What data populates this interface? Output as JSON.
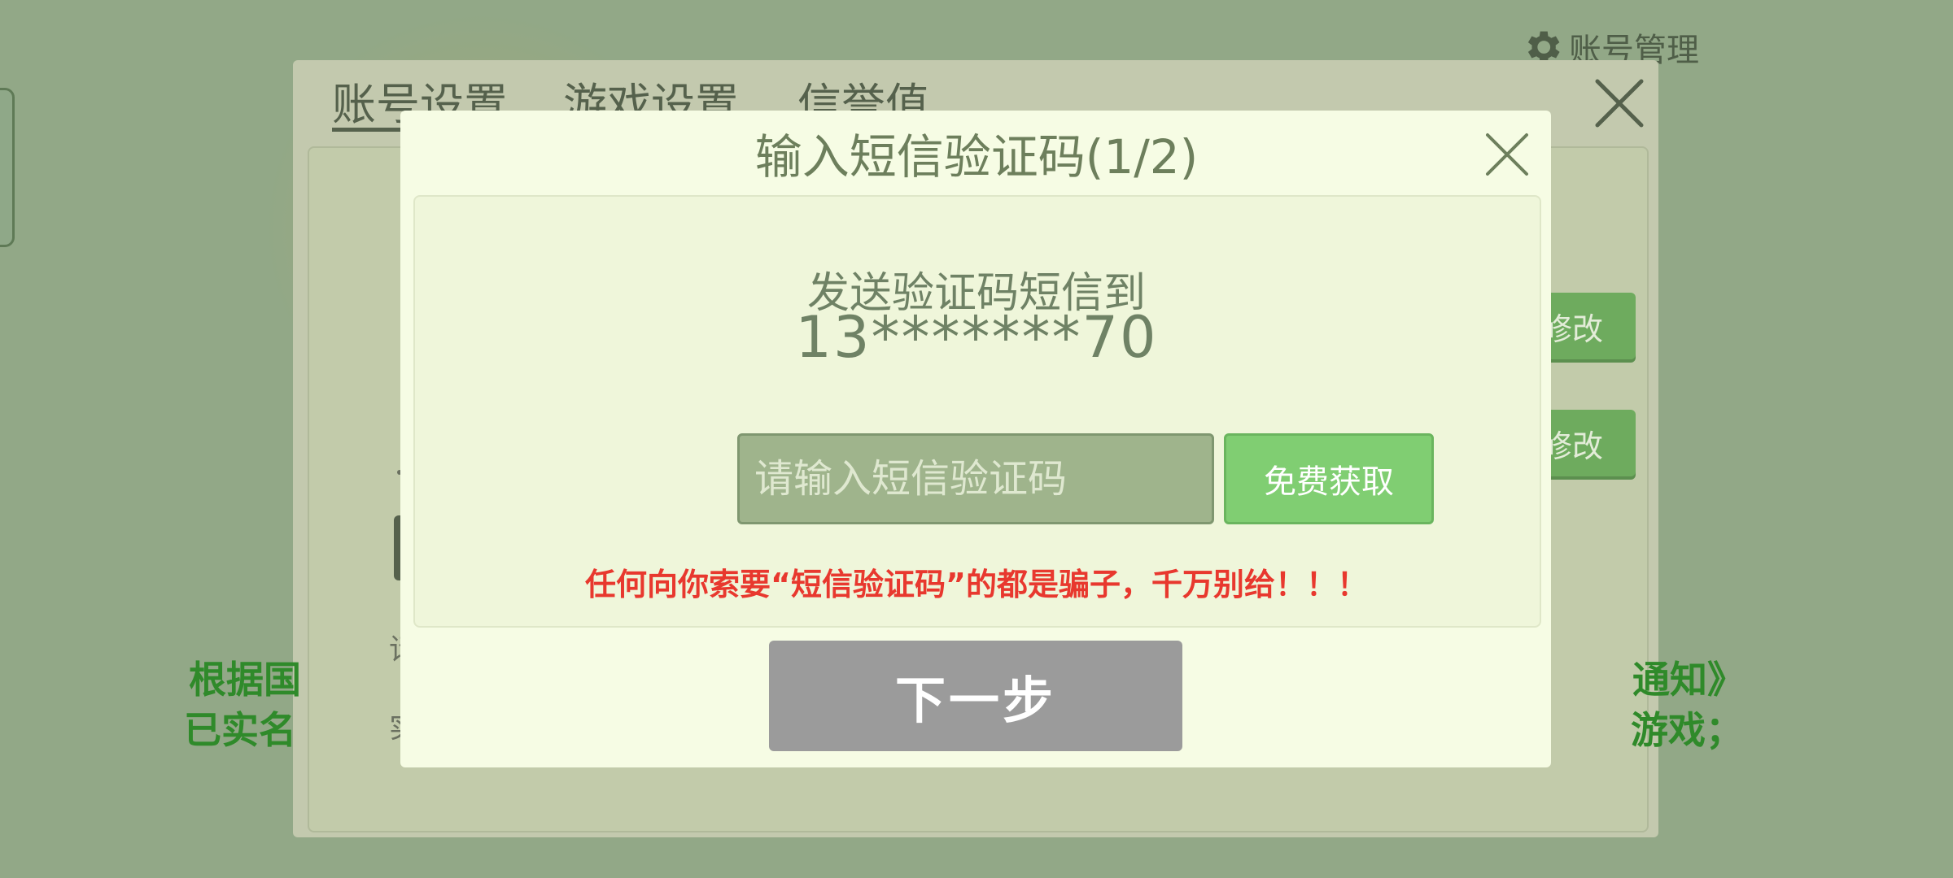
{
  "header": {
    "account_management": "账号管理",
    "icon": "gear-icon"
  },
  "settings": {
    "tabs": [
      {
        "label": "账号设置",
        "active": true
      },
      {
        "label": "游戏设置",
        "active": false
      },
      {
        "label": "信誉值",
        "active": false
      }
    ],
    "modify_label_1": "修改",
    "modify_label_2": "修改",
    "notice_left_1": "根据国",
    "notice_left_2": "已实名",
    "notice_right_1": "通知》",
    "notice_right_2": "游戏；",
    "fragment_1": "请",
    "fragment_2": "实"
  },
  "sms_dialog": {
    "title": "输入短信验证码(1/2)",
    "send_label": "发送验证码短信到",
    "phone": "13*******70",
    "input_placeholder": "请输入短信验证码",
    "get_code_label": "免费获取",
    "warning": "任何向你索要“短信验证码”的都是骗子，千万别给！！！",
    "next_label": "下一步"
  },
  "colors": {
    "background": "#92a887",
    "dialog": "#f6fce4",
    "accent_green": "#80ce72",
    "warning_red": "#e8382e",
    "disabled_gray": "#9b9b9b"
  }
}
